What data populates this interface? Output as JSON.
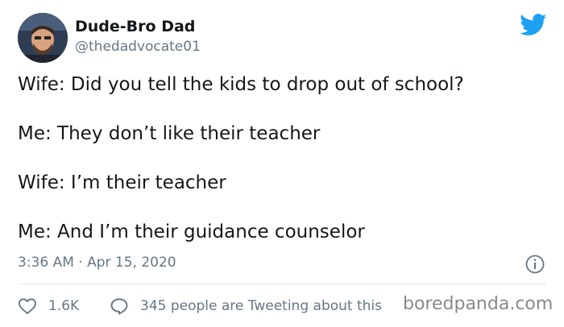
{
  "user": {
    "display_name": "Dude-Bro Dad",
    "handle": "@thedadvocate01"
  },
  "tweet": {
    "lines": [
      "Wife: Did you tell the kids to drop out of school?",
      "Me: They don’t like their teacher",
      "Wife: I’m their teacher",
      "Me: And I’m their guidance counselor"
    ],
    "timestamp": "3:36 AM · Apr 15, 2020"
  },
  "actions": {
    "likes": "1.6K",
    "conversation": "345 people are Tweeting about this"
  },
  "watermark": "boredpanda.com",
  "icons": {
    "brand": "twitter-bird-icon",
    "info": "info-icon",
    "like": "heart-icon",
    "reply": "speech-bubble-icon"
  },
  "colors": {
    "twitter_blue": "#1da1f2",
    "secondary_text": "#657786",
    "primary_text": "#14171a",
    "divider": "#e1e8ed"
  }
}
